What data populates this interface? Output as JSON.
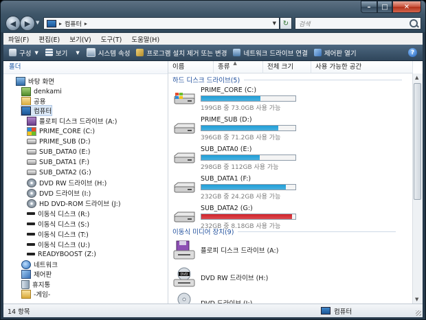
{
  "window": {
    "caption": {
      "minimize": "–",
      "maximize": "□",
      "close": "✕"
    }
  },
  "nav": {
    "address_path": "컴퓨터",
    "search_placeholder": "검색"
  },
  "menu": [
    "파일(F)",
    "편집(E)",
    "보기(V)",
    "도구(T)",
    "도움말(H)"
  ],
  "toolbar": {
    "items": [
      {
        "label": "구성",
        "icon": "organize-icon",
        "dropdown": true
      },
      {
        "label": "보기",
        "icon": "views-icon",
        "dropdown": true
      },
      {
        "label": "시스템 속성",
        "icon": "system-properties-icon",
        "dropdown": false
      },
      {
        "label": "프로그램 설치 제거 또는 변경",
        "icon": "uninstall-program-icon",
        "dropdown": false
      },
      {
        "label": "네트워크 드라이브 연결",
        "icon": "map-network-drive-icon",
        "dropdown": false
      },
      {
        "label": "제어판 열기",
        "icon": "control-panel-icon",
        "dropdown": false
      }
    ],
    "help": "?"
  },
  "left": {
    "header": "폴더",
    "tree": [
      {
        "label": "바탕 화면",
        "icon": "desktop-icon"
      },
      {
        "label": "denkami",
        "icon": "user-folder-icon"
      },
      {
        "label": "공용",
        "icon": "public-folder-icon"
      },
      {
        "label": "컴퓨터",
        "icon": "computer-icon"
      },
      {
        "label": "플로피 디스크 드라이브 (A:)",
        "icon": "floppy-drive-icon"
      },
      {
        "label": "PRIME_CORE (C:)",
        "icon": "windows-drive-icon"
      },
      {
        "label": "PRIME_SUB (D:)",
        "icon": "hard-drive-icon"
      },
      {
        "label": "SUB_DATA0 (E:)",
        "icon": "hard-drive-icon"
      },
      {
        "label": "SUB_DATA1 (F:)",
        "icon": "hard-drive-icon"
      },
      {
        "label": "SUB_DATA2 (G:)",
        "icon": "hard-drive-icon"
      },
      {
        "label": "DVD RW 드라이브 (H:)",
        "icon": "dvd-drive-icon"
      },
      {
        "label": "DVD 드라이브 (I:)",
        "icon": "dvd-drive-icon"
      },
      {
        "label": "HD DVD-ROM 드라이브 (J:)",
        "icon": "dvd-drive-icon"
      },
      {
        "label": "이동식 디스크 (R:)",
        "icon": "removable-disk-icon"
      },
      {
        "label": "이동식 디스크 (S:)",
        "icon": "removable-disk-icon"
      },
      {
        "label": "이동식 디스크 (T:)",
        "icon": "removable-disk-icon"
      },
      {
        "label": "이동식 디스크 (U:)",
        "icon": "removable-disk-icon"
      },
      {
        "label": "READYBOOST (Z:)",
        "icon": "removable-disk-icon"
      },
      {
        "label": "네트워크",
        "icon": "network-icon"
      },
      {
        "label": "제어판",
        "icon": "control-panel-icon"
      },
      {
        "label": "휴지통",
        "icon": "recycle-bin-icon"
      },
      {
        "label": "-게임-",
        "icon": "folder-icon"
      }
    ]
  },
  "columns": [
    "이름",
    "종류",
    "전체 크기",
    "사용 가능한 공간"
  ],
  "groups": {
    "hard": "하드 디스크 드라이브(5)",
    "removable": "이동식 미디어 장치(9)"
  },
  "drives": [
    {
      "name": "PRIME_CORE (C:)",
      "info": "199GB 중 73.0GB 사용 가능",
      "used_fraction": 0.63,
      "color": "#1f9fd8",
      "icon": "windows-drive-icon"
    },
    {
      "name": "PRIME_SUB (D:)",
      "info": "396GB 중 71.2GB 사용 가능",
      "used_fraction": 0.82,
      "color": "#1f9fd8",
      "icon": "hard-drive-icon"
    },
    {
      "name": "SUB_DATA0 (E:)",
      "info": "298GB 중 112GB 사용 가능",
      "used_fraction": 0.62,
      "color": "#1f9fd8",
      "icon": "hard-drive-icon"
    },
    {
      "name": "SUB_DATA1 (F:)",
      "info": "232GB 중 24.2GB 사용 가능",
      "used_fraction": 0.9,
      "color": "#1f9fd8",
      "icon": "hard-drive-icon"
    },
    {
      "name": "SUB_DATA2 (G:)",
      "info": "232GB 중 8.18GB 사용 가능",
      "used_fraction": 0.965,
      "color": "#d2222a",
      "icon": "hard-drive-icon"
    }
  ],
  "removables": [
    {
      "name": "플로피 디스크 드라이브 (A:)",
      "icon": "floppy-drive-icon"
    },
    {
      "name": "DVD RW 드라이브 (H:)",
      "icon": "dvd-drive-icon"
    },
    {
      "name": "DVD 드라이브 (I:)",
      "icon": "dvd-drive-icon"
    }
  ],
  "status": {
    "count": "14 항목",
    "location": "컴퓨터"
  }
}
